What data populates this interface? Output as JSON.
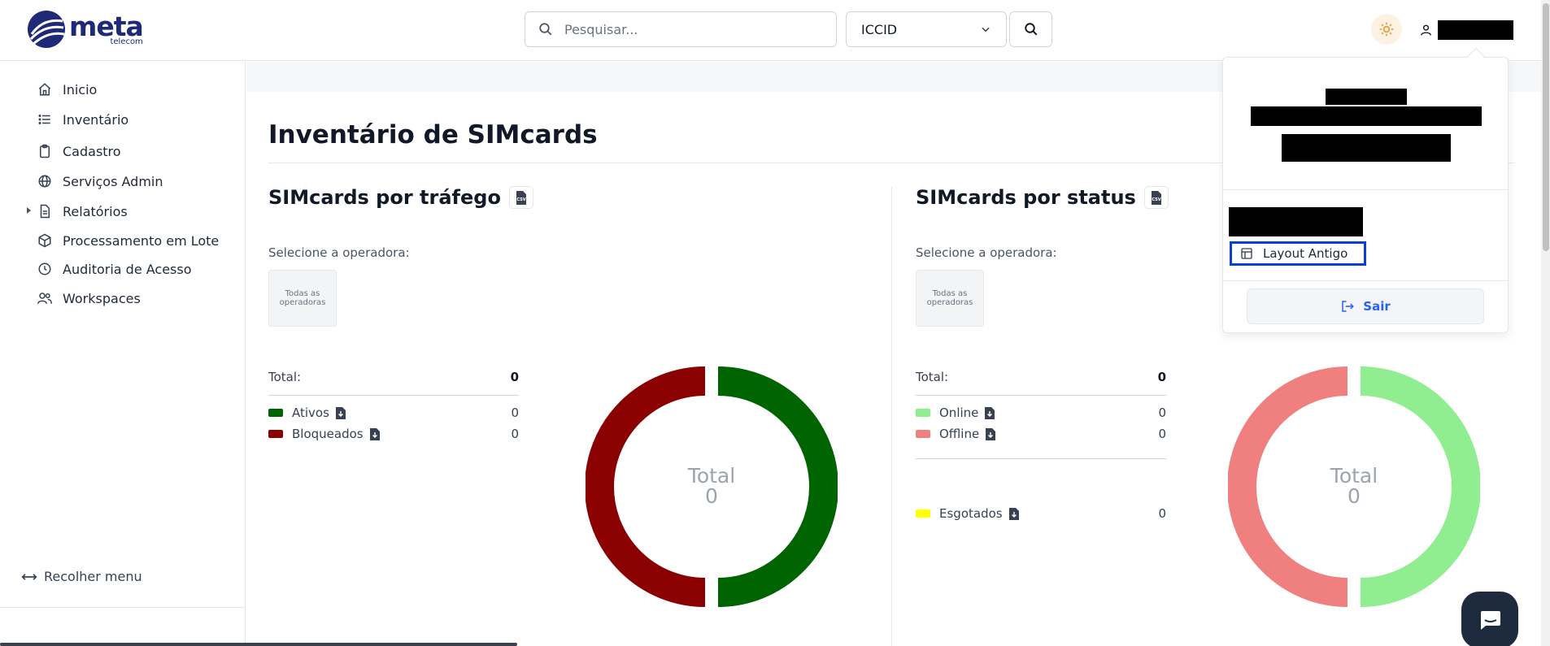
{
  "header": {
    "logo_main": "meta",
    "logo_sub": "telecom",
    "search_placeholder": "Pesquisar...",
    "filter_selected": "ICCID"
  },
  "sidebar": {
    "items": [
      {
        "label": "Inicio",
        "icon": "home-icon"
      },
      {
        "label": "Inventário",
        "icon": "list-icon"
      },
      {
        "label": "Cadastro",
        "icon": "clipboard-icon"
      },
      {
        "label": "Serviços Admin",
        "icon": "globe-icon"
      },
      {
        "label": "Relatórios",
        "icon": "document-icon"
      },
      {
        "label": "Processamento em Lote",
        "icon": "package-icon"
      },
      {
        "label": "Auditoria de Acesso",
        "icon": "clock-icon"
      },
      {
        "label": "Workspaces",
        "icon": "users-icon"
      }
    ],
    "collapse_label": "Recolher menu"
  },
  "main": {
    "title": "Inventário de SIMcards",
    "traffic": {
      "title": "SIMcards por tráfego",
      "select_label": "Selecione a operadora:",
      "operator_button": "Todas as operadoras",
      "total_label": "Total:",
      "total_value": "0",
      "legend": [
        {
          "label": "Ativos",
          "value": "0",
          "color": "#006400"
        },
        {
          "label": "Bloqueados",
          "value": "0",
          "color": "#8b0000"
        }
      ],
      "donut_label": "Total",
      "donut_value": "0"
    },
    "status": {
      "title": "SIMcards por status",
      "select_label": "Selecione a operadora:",
      "operator_button": "Todas as operadoras",
      "total_label": "Total:",
      "total_value": "0",
      "legend": [
        {
          "label": "Online",
          "value": "0",
          "color": "#90ee90"
        },
        {
          "label": "Offline",
          "value": "0",
          "color": "#f08080"
        },
        {
          "label": "Esgotados",
          "value": "0",
          "color": "#ffff00"
        }
      ],
      "donut_label": "Total",
      "donut_value": "0"
    }
  },
  "user_menu": {
    "layout_button": "Layout Antigo",
    "logout_button": "Sair"
  }
}
